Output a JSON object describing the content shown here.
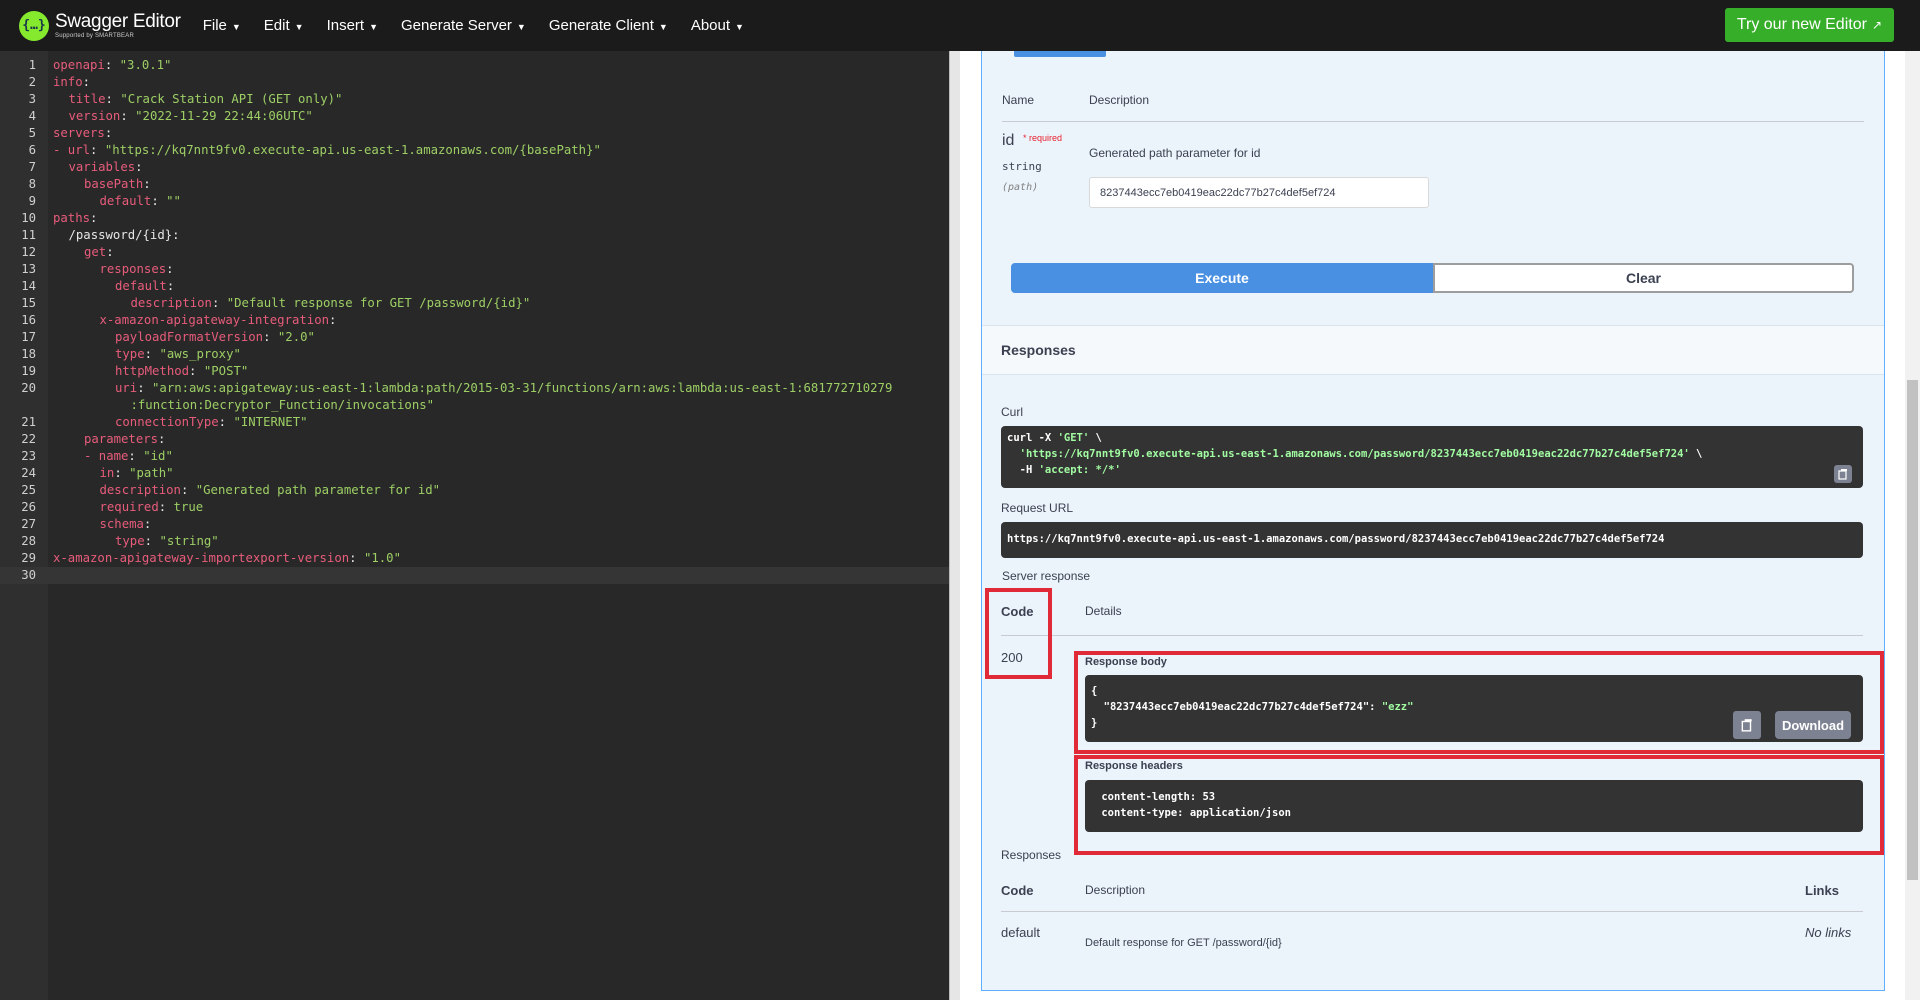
{
  "topbar": {
    "logo_title": "Swagger Editor",
    "logo_sub": "Supported by SMARTBEAR",
    "menu": [
      {
        "label": "File"
      },
      {
        "label": "Edit"
      },
      {
        "label": "Insert"
      },
      {
        "label": "Generate Server"
      },
      {
        "label": "Generate Client"
      },
      {
        "label": "About"
      }
    ],
    "try_button": "Try our new Editor",
    "caret": "▼",
    "ext_icon": "↗"
  },
  "editor": {
    "lines": [
      {
        "n": "1",
        "indent": 0,
        "key": "openapi",
        "sep": ": ",
        "val": "\"3.0.1\""
      },
      {
        "n": "2",
        "indent": 0,
        "key": "info",
        "sep": ":",
        "val": ""
      },
      {
        "n": "3",
        "indent": 1,
        "key": "title",
        "sep": ": ",
        "val": "\"Crack Station API (GET only)\""
      },
      {
        "n": "4",
        "indent": 1,
        "key": "version",
        "sep": ": ",
        "val": "\"2022-11-29 22:44:06UTC\""
      },
      {
        "n": "5",
        "indent": 0,
        "key": "servers",
        "sep": ":",
        "val": ""
      },
      {
        "n": "6",
        "indent": 0,
        "key": "- url",
        "sep": ": ",
        "val": "\"https://kq7nnt9fv0.execute-api.us-east-1.amazonaws.com/{basePath}\""
      },
      {
        "n": "7",
        "indent": 1,
        "key": "variables",
        "sep": ":",
        "val": ""
      },
      {
        "n": "8",
        "indent": 2,
        "key": "basePath",
        "sep": ":",
        "val": ""
      },
      {
        "n": "9",
        "indent": 3,
        "key": "default",
        "sep": ": ",
        "val": "\"\""
      },
      {
        "n": "10",
        "indent": 0,
        "key": "paths",
        "sep": ":",
        "val": ""
      },
      {
        "n": "11",
        "indent": 1,
        "key": "",
        "sep": "",
        "val": "",
        "plain": "/password/{id}:"
      },
      {
        "n": "12",
        "indent": 2,
        "key": "get",
        "sep": ":",
        "val": ""
      },
      {
        "n": "13",
        "indent": 3,
        "key": "responses",
        "sep": ":",
        "val": ""
      },
      {
        "n": "14",
        "indent": 4,
        "key": "default",
        "sep": ":",
        "val": ""
      },
      {
        "n": "15",
        "indent": 5,
        "key": "description",
        "sep": ": ",
        "val": "\"Default response for GET /password/{id}\""
      },
      {
        "n": "16",
        "indent": 3,
        "key": "x-amazon-apigateway-integration",
        "sep": ":",
        "val": ""
      },
      {
        "n": "17",
        "indent": 4,
        "key": "payloadFormatVersion",
        "sep": ": ",
        "val": "\"2.0\""
      },
      {
        "n": "18",
        "indent": 4,
        "key": "type",
        "sep": ": ",
        "val": "\"aws_proxy\""
      },
      {
        "n": "19",
        "indent": 4,
        "key": "httpMethod",
        "sep": ": ",
        "val": "\"POST\""
      },
      {
        "n": "20",
        "indent": 4,
        "key": "uri",
        "sep": ": ",
        "val": "\"arn:aws:apigateway:us-east-1:lambda:path/2015-03-31/functions/arn:aws:lambda:us-east-1:681772710279"
      },
      {
        "n": "",
        "indent": 5,
        "key": "",
        "sep": "",
        "val": ":function:Decryptor_Function/invocations\""
      },
      {
        "n": "21",
        "indent": 4,
        "key": "connectionType",
        "sep": ": ",
        "val": "\"INTERNET\""
      },
      {
        "n": "22",
        "indent": 2,
        "key": "parameters",
        "sep": ":",
        "val": ""
      },
      {
        "n": "23",
        "indent": 2,
        "key": "- name",
        "sep": ": ",
        "val": "\"id\""
      },
      {
        "n": "24",
        "indent": 3,
        "key": "in",
        "sep": ": ",
        "val": "\"path\""
      },
      {
        "n": "25",
        "indent": 3,
        "key": "description",
        "sep": ": ",
        "val": "\"Generated path parameter for id\""
      },
      {
        "n": "26",
        "indent": 3,
        "key": "required",
        "sep": ": ",
        "val": "true"
      },
      {
        "n": "27",
        "indent": 3,
        "key": "schema",
        "sep": ":",
        "val": ""
      },
      {
        "n": "28",
        "indent": 4,
        "key": "type",
        "sep": ": ",
        "val": "\"string\""
      },
      {
        "n": "29",
        "indent": 0,
        "key": "x-amazon-apigateway-importexport-version",
        "sep": ": ",
        "val": "\"1.0\""
      },
      {
        "n": "30",
        "indent": 0,
        "key": "",
        "sep": "",
        "val": ""
      }
    ]
  },
  "params": {
    "col_name": "Name",
    "col_desc": "Description",
    "name": "id",
    "required_mark": "*",
    "required_text": "required",
    "type": "string",
    "in": "(path)",
    "description": "Generated path parameter for id",
    "value": "8237443ecc7eb0419eac22dc77b27c4def5ef724"
  },
  "actions": {
    "execute": "Execute",
    "clear": "Clear"
  },
  "responses_title": "Responses",
  "curl": {
    "label": "Curl",
    "line1_a": "curl -X ",
    "line1_b": "'GET'",
    "line1_c": " \\",
    "line2": "  'https://kq7nnt9fv0.execute-api.us-east-1.amazonaws.com/password/8237443ecc7eb0419eac22dc77b27c4def5ef724'",
    "line2_end": " \\",
    "line3_a": "  -H ",
    "line3_b": "'accept: */*'"
  },
  "request_url": {
    "label": "Request URL",
    "value": "https://kq7nnt9fv0.execute-api.us-east-1.amazonaws.com/password/8237443ecc7eb0419eac22dc77b27c4def5ef724"
  },
  "server_response": {
    "label": "Server response",
    "col_code": "Code",
    "col_details": "Details",
    "code": "200",
    "body_label": "Response body",
    "body_open": "{",
    "body_key": "  \"8237443ecc7eb0419eac22dc77b27c4def5ef724\"",
    "body_colon": ": ",
    "body_val": "\"ezz\"",
    "body_close": "}",
    "download": "Download",
    "headers_label": "Response headers",
    "header1": " content-length: 53",
    "header2": " content-type: application/json"
  },
  "responses_table": {
    "label": "Responses",
    "col_code": "Code",
    "col_desc": "Description",
    "col_links": "Links",
    "code": "default",
    "desc": "Default response for GET /password/{id}",
    "links": "No links"
  },
  "colors": {
    "accent": "#4990e2",
    "highlight": "#e12a37",
    "topbar": "#1b1b1b",
    "try": "#36ae2a"
  }
}
